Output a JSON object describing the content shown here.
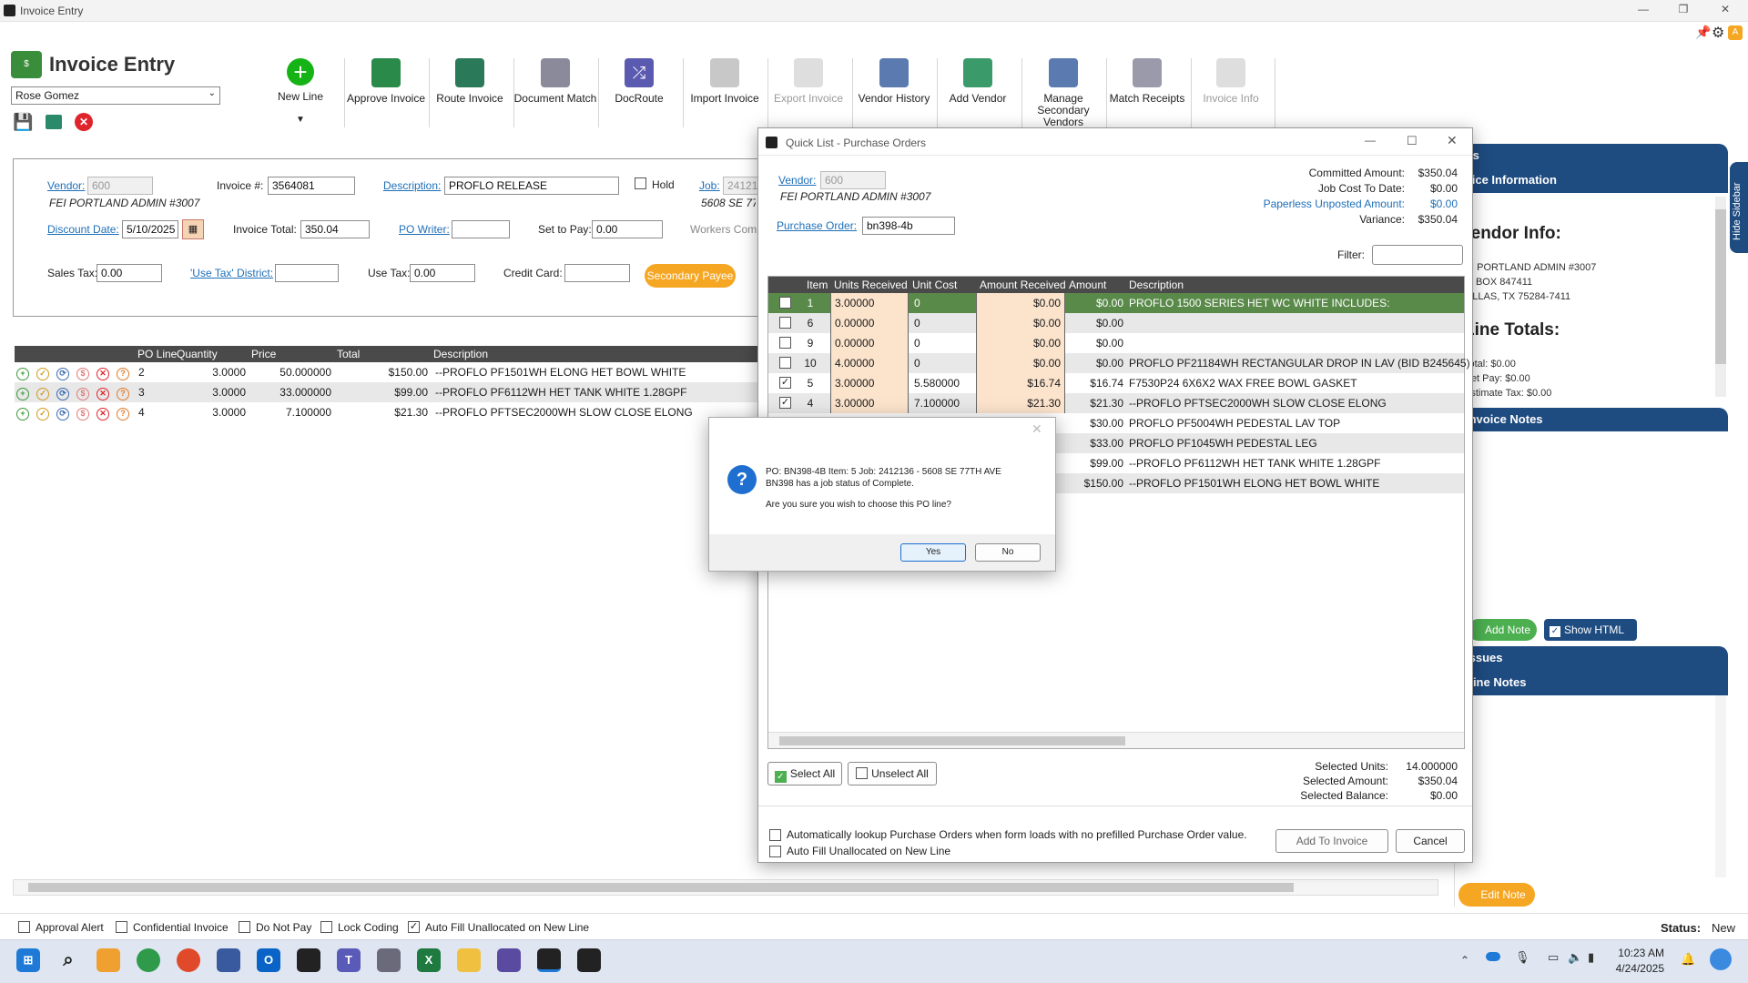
{
  "app": {
    "window_title": "Invoice Entry",
    "title": "Invoice Entry",
    "user": "Rose Gomez"
  },
  "ribbon": [
    "New Line",
    "Approve Invoice",
    "Route Invoice",
    "Document Match",
    "DocRoute",
    "Import Invoice",
    "Export Invoice",
    "Vendor History",
    "Add Vendor",
    "Manage Secondary Vendors",
    "Match Receipts",
    "Invoice Info"
  ],
  "header": {
    "vendor_label": "Vendor:",
    "vendor_code": "600",
    "vendor_name": "FEI PORTLAND ADMIN #3007",
    "invoice_no_label": "Invoice #:",
    "invoice_no": "3564081",
    "description_label": "Description:",
    "description": "PROFLO RELEASE",
    "hold_label": "Hold",
    "job_label": "Job:",
    "job_value": "2412136",
    "job_address": "5608 SE 77TH AVE",
    "discount_date_label": "Discount Date:",
    "discount_date": "5/10/2025",
    "invoice_total_label": "Invoice Total:",
    "invoice_total": "350.04",
    "po_writer_label": "PO Writer:",
    "set_to_pay_label": "Set to Pay:",
    "set_to_pay": "0.00",
    "workers_comp_label": "Workers Comp",
    "sales_tax_label": "Sales Tax:",
    "sales_tax": "0.00",
    "use_tax_district_label": "'Use Tax' District:",
    "use_tax_label": "Use Tax:",
    "use_tax": "0.00",
    "credit_card_label": "Credit Card:",
    "secondary_payee": "Secondary Payee"
  },
  "lines": {
    "columns": [
      "PO Line",
      "Quantity",
      "Price",
      "Total",
      "Description"
    ],
    "rows": [
      {
        "po_line": "2",
        "qty": "3.0000",
        "price": "50.000000",
        "total": "$150.00",
        "desc": "--PROFLO PF1501WH ELONG HET BOWL WHITE"
      },
      {
        "po_line": "3",
        "qty": "3.0000",
        "price": "33.000000",
        "total": "$99.00",
        "desc": "--PROFLO PF6112WH HET TANK WHITE 1.28GPF"
      },
      {
        "po_line": "4",
        "qty": "3.0000",
        "price": "7.100000",
        "total": "$21.30",
        "desc": "--PROFLO PFTSEC2000WH SLOW CLOSE ELONG"
      }
    ]
  },
  "footer": {
    "checks": [
      "Approval Alert",
      "Confidential Invoice",
      "Do Not Pay",
      "Lock Coding",
      "Auto Fill Unallocated on New Line"
    ],
    "status_label": "Status:",
    "status_value": "New"
  },
  "sidebar": {
    "tab_label": "Hide Sidebar",
    "alerts": "Alerts",
    "invoice_info": "Invoice Information",
    "vendor_info_heading": "Vendor Info:",
    "vendor_lines": [
      "FEI PORTLAND ADMIN #3007",
      "PO BOX 847411",
      "DALLAS, TX 75284-7411"
    ],
    "line_totals_heading": "Line Totals:",
    "totals": [
      "Total: $0.00",
      "Net Pay: $0.00",
      "Estimate Tax: $0.00"
    ],
    "invoice_notes": "Invoice Notes",
    "add_note": "Add Note",
    "show_html": "Show HTML",
    "issues": "Issues",
    "line_notes": "Line Notes",
    "edit_note": "Edit Note"
  },
  "quicklist": {
    "title": "Quick List - Purchase Orders",
    "vendor_label": "Vendor:",
    "vendor_code": "600",
    "vendor_name": "FEI PORTLAND ADMIN #3007",
    "po_label": "Purchase Order:",
    "po_value": "bn398-4b",
    "summary": [
      {
        "label": "Committed Amount:",
        "value": "$350.04"
      },
      {
        "label": "Job Cost To Date:",
        "value": "$0.00"
      },
      {
        "label": "Paperless Unposted Amount:",
        "value": "$0.00"
      },
      {
        "label": "Variance:",
        "value": "$350.04"
      }
    ],
    "filter_label": "Filter:",
    "columns": [
      "Item",
      "Units Received",
      "Unit Cost",
      "Amount Received",
      "Amount",
      "Description"
    ],
    "rows": [
      {
        "checked": false,
        "item": "1",
        "units": "3.00000",
        "cost": "0",
        "received": "$0.00",
        "amount": "$0.00",
        "desc": "PROFLO 1500 SERIES HET WC WHITE INCLUDES:"
      },
      {
        "checked": false,
        "item": "6",
        "units": "0.00000",
        "cost": "0",
        "received": "$0.00",
        "amount": "$0.00",
        "desc": ""
      },
      {
        "checked": false,
        "item": "9",
        "units": "0.00000",
        "cost": "0",
        "received": "$0.00",
        "amount": "$0.00",
        "desc": ""
      },
      {
        "checked": false,
        "item": "10",
        "units": "4.00000",
        "cost": "0",
        "received": "$0.00",
        "amount": "$0.00",
        "desc": "PROFLO PF21184WH  RECTANGULAR DROP IN LAV (BID B245645)"
      },
      {
        "checked": true,
        "item": "5",
        "units": "3.00000",
        "cost": "5.580000",
        "received": "$16.74",
        "amount": "$16.74",
        "desc": "F7530P24 6X6X2 WAX FREE BOWL GASKET"
      },
      {
        "checked": true,
        "item": "4",
        "units": "3.00000",
        "cost": "7.100000",
        "received": "$21.30",
        "amount": "$21.30",
        "desc": "--PROFLO PFTSEC2000WH SLOW CLOSE ELONG"
      },
      {
        "checked": false,
        "item": "",
        "units": "",
        "cost": "",
        "received": "",
        "amount": "$30.00",
        "desc": "PROFLO PF5004WH PEDESTAL LAV TOP"
      },
      {
        "checked": false,
        "item": "",
        "units": "",
        "cost": "",
        "received": "",
        "amount": "$33.00",
        "desc": "PROFLO PF1045WH PEDESTAL LEG"
      },
      {
        "checked": false,
        "item": "",
        "units": "",
        "cost": "",
        "received": "",
        "amount": "$99.00",
        "desc": "--PROFLO PF6112WH HET TANK WHITE 1.28GPF"
      },
      {
        "checked": false,
        "item": "",
        "units": "",
        "cost": "",
        "received": "",
        "amount": "$150.00",
        "desc": "--PROFLO PF1501WH ELONG HET BOWL WHITE"
      }
    ],
    "select_all": "Select All",
    "unselect_all": "Unselect All",
    "selected": [
      {
        "label": "Selected Units:",
        "value": "14.000000"
      },
      {
        "label": "Selected Amount:",
        "value": "$350.04"
      },
      {
        "label": "Selected Balance:",
        "value": "$0.00"
      }
    ],
    "opt1": "Automatically lookup Purchase Orders when form loads with no prefilled Purchase Order value.",
    "opt2": "Auto Fill Unallocated on New Line",
    "add_to_invoice": "Add To Invoice",
    "cancel": "Cancel"
  },
  "dialog": {
    "line1": "PO:  BN398-4B  Item:  5  Job:  2412136 - 5608 SE 77TH AVE",
    "line2": "BN398 has a job status of Complete.",
    "question": "Are you sure you wish to choose this PO line?",
    "yes": "Yes",
    "no": "No"
  },
  "taskbar": {
    "time": "10:23 AM",
    "date": "4/24/2025"
  },
  "colors": {
    "accent_green": "#5a8a4a",
    "sidebar_blue": "#1e4b80",
    "orange": "#f5a623",
    "link": "#1e6fb8"
  }
}
